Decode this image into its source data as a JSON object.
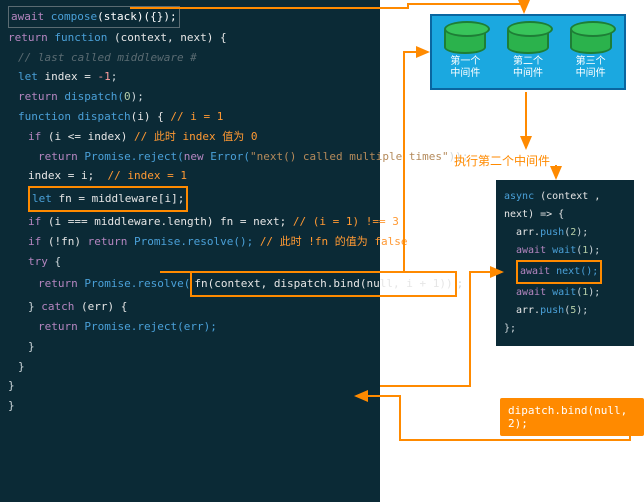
{
  "main_code": {
    "l1_await": "await",
    "l1_compose": "compose",
    "l1_stack_call": "(stack)({});",
    "l2_return": "return",
    "l2_function": "function",
    "l2_rest": " (context, next) {",
    "l3_comment": "// last called middleware #",
    "l4_let": "let",
    "l4_rest": " index = ",
    "l4_val": "-1",
    "l4_semi": ";",
    "l5_return": "return",
    "l5_call": " dispatch(",
    "l5_arg": "0",
    "l5_close": ");",
    "l6_function": "function",
    "l6_name": " dispatch",
    "l6_params": "(i) { ",
    "l6_comment": "// i = 1",
    "l7_if": "if",
    "l7_cond": " (i <= index) ",
    "l7_comment": "// 此时 index 值为 0",
    "l8_return": "return",
    "l8_promise": " Promise",
    "l8_reject": ".reject(",
    "l8_new": "new",
    "l8_err": " Error(",
    "l8_str": "\"next() called multiple times\"",
    "l8_close": "));",
    "l9_lhs": "index = i;  ",
    "l9_comment": "// index = 1",
    "l10_let": "let",
    "l10_rest": " fn = middleware[i];",
    "l11_if": "if",
    "l11_cond": " (i === middleware.length) fn = next; ",
    "l11_comment": "// (i = 1) !== 3",
    "l12_if": "if",
    "l12_cond": " (!fn) ",
    "l12_return": "return",
    "l12_promise": " Promise.resolve(); ",
    "l12_comment": "// 此时 !fn 的值为 false",
    "l13_try": "try",
    "l13_brace": " {",
    "l14_return": "return",
    "l14_lead": " Promise.resolve(",
    "l14_box": "fn(context, dispatch.bind(null, i + 1))",
    "l14_close": ";",
    "l15_catch_brace": "} ",
    "l15_catch": "catch",
    "l15_catch_rest": " (err) {",
    "l16_return": "return",
    "l16_rest": " Promise.reject(err);",
    "l17": "}",
    "l18": "}",
    "l19": "}",
    "l20": "}"
  },
  "stack": {
    "items": [
      {
        "title": "第一个",
        "sub": "中间件"
      },
      {
        "title": "第二个",
        "sub": "中间件"
      },
      {
        "title": "第三个",
        "sub": "中间件"
      }
    ]
  },
  "exec_label": "执行第二个中间件",
  "async_code": {
    "sig_async": "async",
    "sig_rest": " (context , next) => {",
    "l1_a": "arr.",
    "l1_push": "push",
    "l1_b": "(",
    "l1_n": "2",
    "l1_c": ");",
    "l2_await": "await",
    "l2_wait": " wait",
    "l2_p": "(",
    "l2_n": "1",
    "l2_c": ");",
    "l3_await": "await",
    "l3_next": " next();",
    "l4_await": "await",
    "l4_wait": " wait",
    "l4_p": "(",
    "l4_n": "1",
    "l4_c": ");",
    "l5_a": "arr.",
    "l5_push": "push",
    "l5_b": "(",
    "l5_n": "5",
    "l5_c": ");",
    "end": "};"
  },
  "dispatch_badge": "dipatch.bind(null, 2);"
}
